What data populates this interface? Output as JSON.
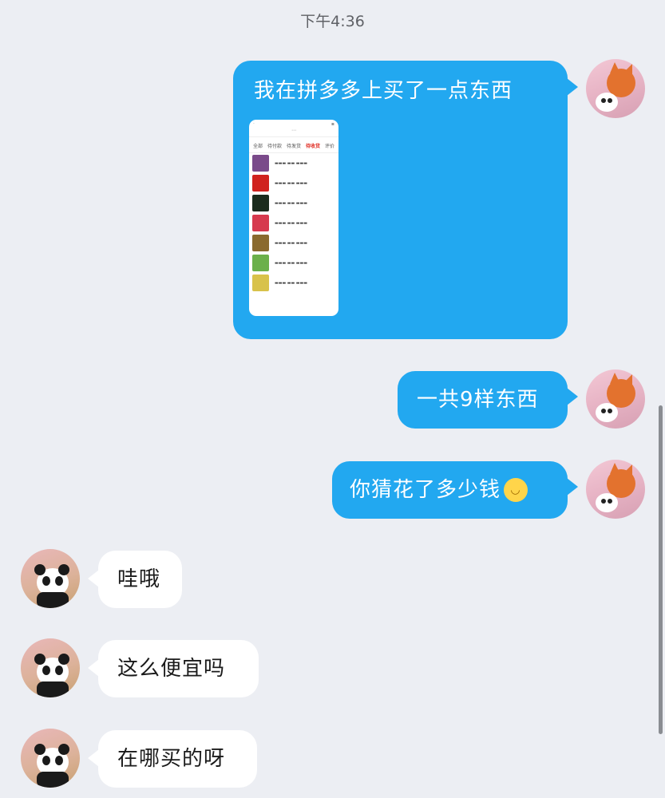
{
  "status": {
    "time": "下午4:36"
  },
  "messages": [
    {
      "id": "m1",
      "side": "out",
      "text": "我在拼多多上买了一点东西"
    },
    {
      "id": "m2",
      "side": "out",
      "text": "一共9样东西"
    },
    {
      "id": "m3",
      "side": "out",
      "text": "你猜花了多少钱",
      "emoji": "smile-emoji"
    },
    {
      "id": "m4",
      "side": "in",
      "text": "哇哦"
    },
    {
      "id": "m5",
      "side": "in",
      "text": "这么便宜吗"
    },
    {
      "id": "m6",
      "side": "in",
      "text": "在哪买的呀"
    }
  ],
  "attachment": {
    "type": "screenshot",
    "tabs": [
      "全部",
      "待付款",
      "待发货",
      "待收货",
      "评价"
    ],
    "active_tab": 3,
    "items": [
      {
        "thumb_color": "#7a4a8a"
      },
      {
        "thumb_color": "#d0221e"
      },
      {
        "thumb_color": "#1b2b1d"
      },
      {
        "thumb_color": "#d63a4e"
      },
      {
        "thumb_color": "#8a6a2e"
      },
      {
        "thumb_color": "#6bb04a"
      },
      {
        "thumb_color": "#d8c24a"
      }
    ]
  },
  "avatars": {
    "me": "cat-avatar",
    "them": "panda-avatar"
  },
  "colors": {
    "outgoing_bubble": "#22a8f0",
    "incoming_bubble": "#ffffff",
    "background": "#eceef3"
  }
}
